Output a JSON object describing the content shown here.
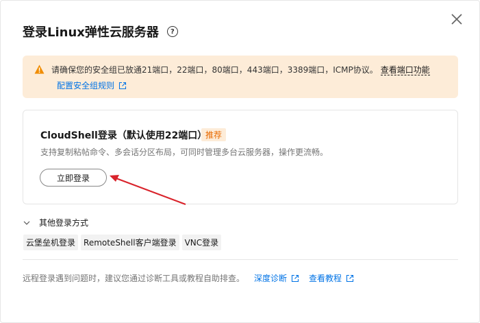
{
  "dialog": {
    "title": "登录Linux弹性云服务器",
    "help_icon": "?",
    "close_icon": "close-icon"
  },
  "alert": {
    "icon": "warning-icon",
    "message": "请确保您的安全组已放通21端口，22端口，80端口，443端口，3389端口，ICMP协议。",
    "ports_link": "查看端口功能",
    "rules_link": "配置安全组规则"
  },
  "cloudshell": {
    "title": "CloudShell登录（默认使用22端口）",
    "badge": "推荐",
    "description": "支持复制粘帖命令、多会话分区布局，可同时管理多台云服务器，操作更流畅。",
    "login_button": "立即登录"
  },
  "other_methods": {
    "toggle_label": "其他登录方式",
    "methods": [
      "云堡垒机登录",
      "RemoteShell客户端登录",
      "VNC登录"
    ]
  },
  "footer": {
    "text": "远程登录遇到问题时，建议您通过诊断工具或教程自助排查。",
    "diag_link": "深度诊断",
    "tutorial_link": "查看教程"
  },
  "colors": {
    "link": "#0073e6",
    "alert_bg": "#fdecd8",
    "warning": "#f08c00",
    "badge_text": "#e86a00",
    "annotation_arrow": "#d9232b"
  }
}
